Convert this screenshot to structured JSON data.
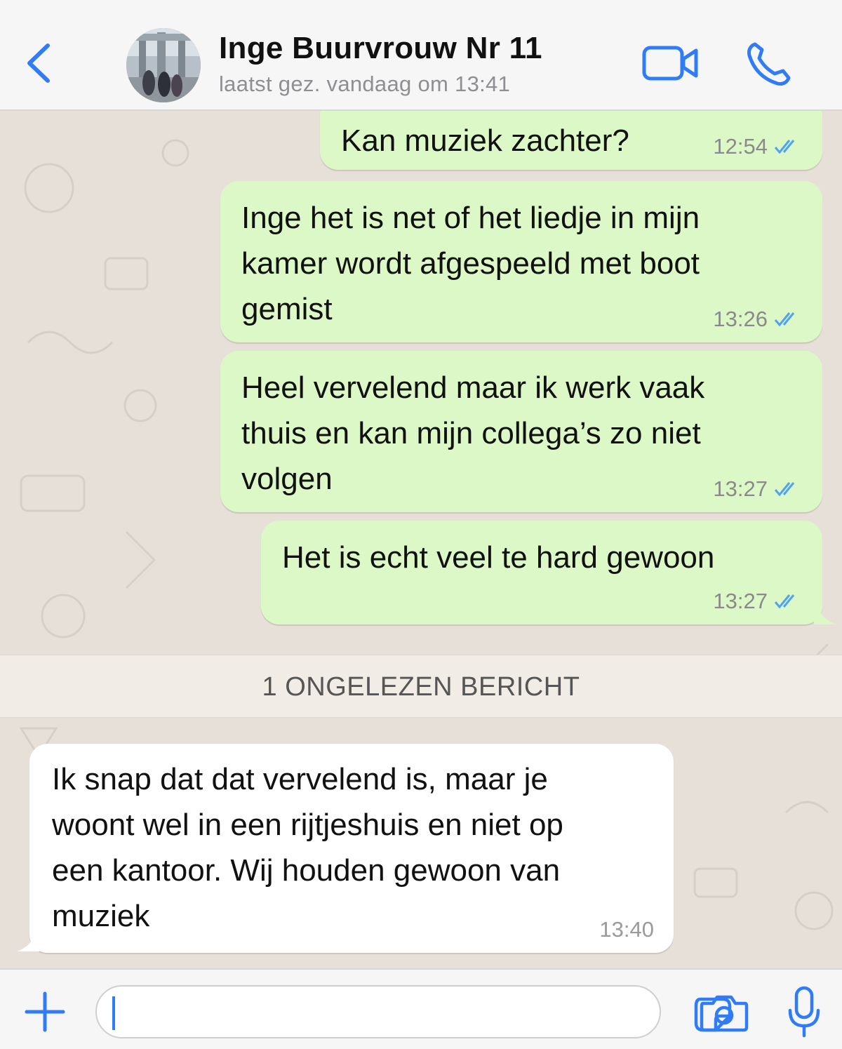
{
  "header": {
    "back_label": "",
    "contact_name": "Inge Buurvrouw Nr 11",
    "last_seen": "laatst gez. vandaag om 13:41"
  },
  "messages": [
    {
      "direction": "outgoing",
      "text": "Kan muziek zachter?",
      "time": "12:54",
      "status": "read"
    },
    {
      "direction": "outgoing",
      "text": "Inge het is net of het liedje in mijn\nkamer wordt afgespeeld met boot\ngemist",
      "time": "13:26",
      "status": "read"
    },
    {
      "direction": "outgoing",
      "text": "Heel vervelend maar ik werk vaak\nthuis en kan mijn collega’s zo niet\nvolgen",
      "time": "13:27",
      "status": "read"
    },
    {
      "direction": "outgoing",
      "text": "Het is echt veel te hard gewoon",
      "time": "13:27",
      "status": "read"
    },
    {
      "direction": "incoming",
      "text": "Ik snap dat dat vervelend is, maar je\nwoont wel in een rijtjeshuis en niet op\neen kantoor. Wij houden gewoon van\nmuziek",
      "time": "13:40"
    }
  ],
  "unread_divider": "1 ONGELEZEN BERICHT",
  "input": {
    "value": "",
    "placeholder": ""
  },
  "icons": {
    "back": "chevron-left-icon",
    "video": "video-camera-icon",
    "call": "phone-icon",
    "plus": "plus-icon",
    "sticker": "sticker-icon",
    "camera": "camera-icon",
    "mic": "microphone-icon"
  },
  "colors": {
    "accent": "#2f7cf6",
    "outgoing_bubble": "#dcf8c6",
    "incoming_bubble": "#ffffff",
    "read_ticks": "#4fa3f7"
  }
}
